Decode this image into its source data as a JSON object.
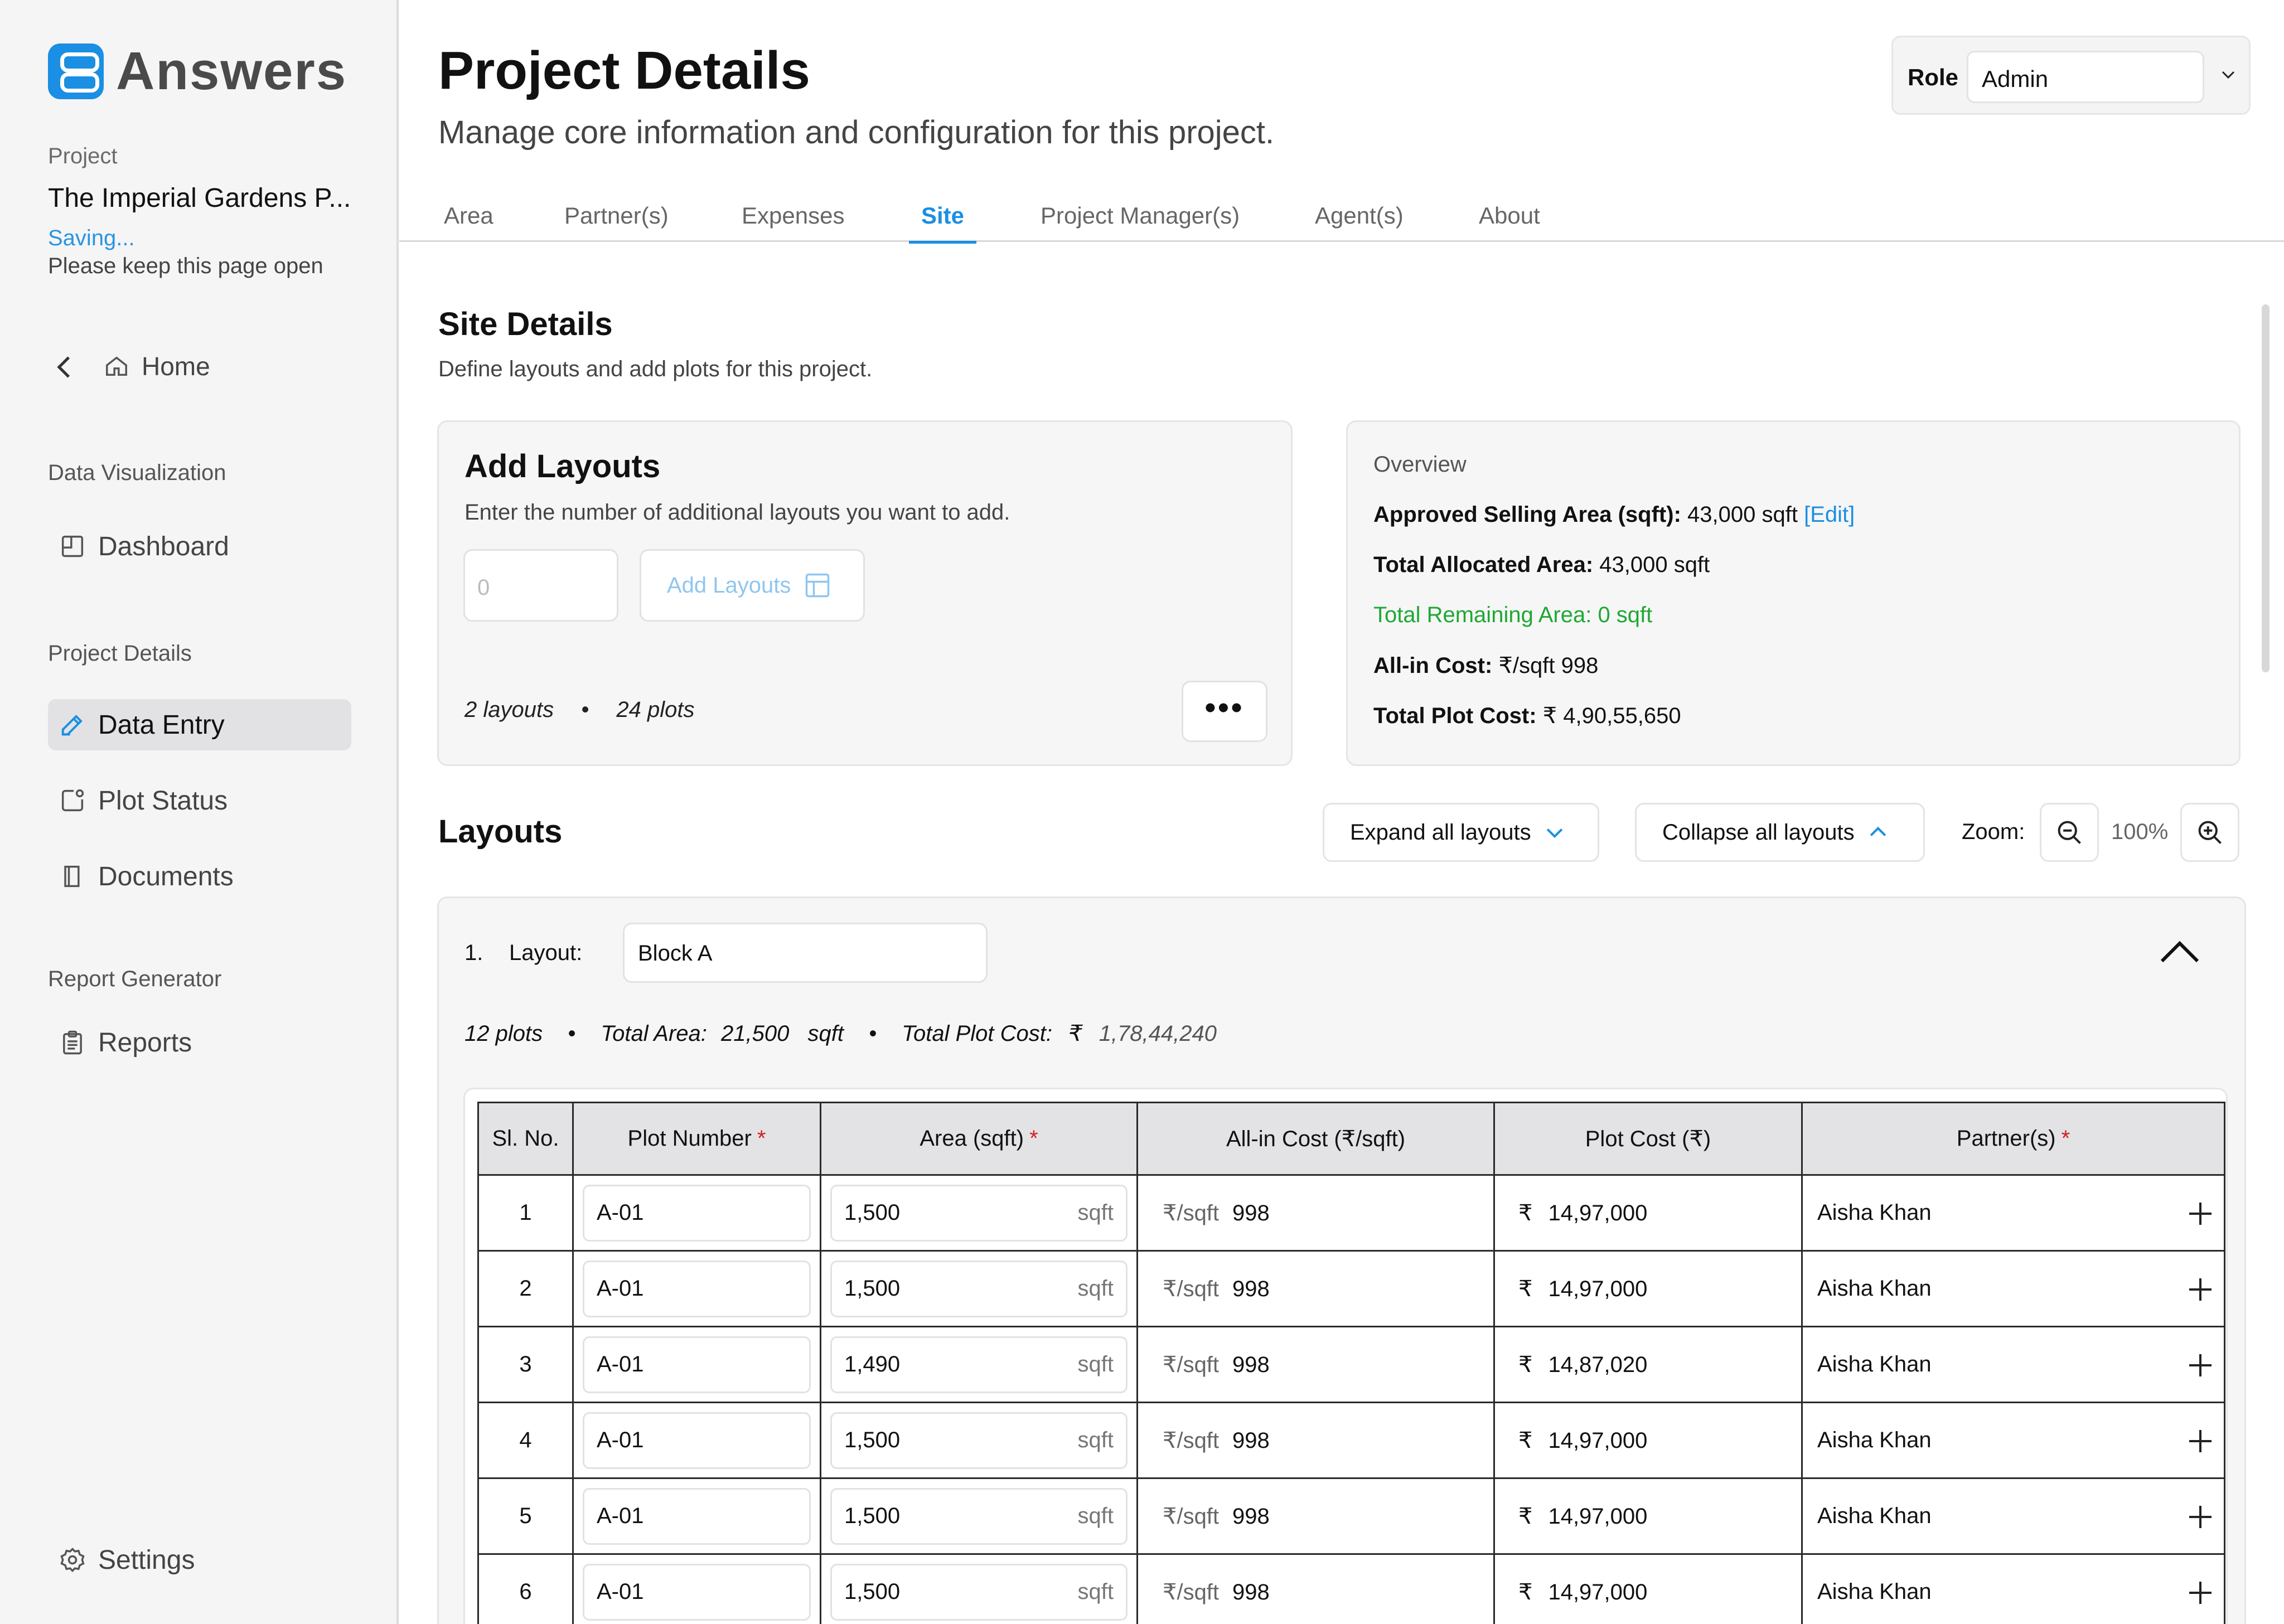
{
  "app": {
    "name": "Answers"
  },
  "sidebar": {
    "project_label": "Project",
    "project_name": "The Imperial Gardens P...",
    "saving": "Saving...",
    "keep_open": "Please keep this page open",
    "home": "Home",
    "sections": [
      {
        "title": "Data Visualization",
        "items": [
          {
            "label": "Dashboard",
            "icon": "dashboard-icon"
          }
        ]
      },
      {
        "title": "Project Details",
        "items": [
          {
            "label": "Data Entry",
            "icon": "edit-icon",
            "active": true
          },
          {
            "label": "Plot Status",
            "icon": "plot-status-icon"
          },
          {
            "label": "Documents",
            "icon": "document-icon"
          }
        ]
      },
      {
        "title": "Report Generator",
        "items": [
          {
            "label": "Reports",
            "icon": "clipboard-icon"
          }
        ]
      }
    ],
    "settings": "Settings"
  },
  "header": {
    "title": "Project Details",
    "subtitle": "Manage core information and configuration for this project.",
    "role_label": "Role",
    "role_value": "Admin"
  },
  "tabs": [
    "Area",
    "Partner(s)",
    "Expenses",
    "Site",
    "Project Manager(s)",
    "Agent(s)",
    "About"
  ],
  "active_tab": "Site",
  "site": {
    "title": "Site Details",
    "subtitle": "Define layouts and add plots for this project."
  },
  "add_layouts": {
    "title": "Add Layouts",
    "subtitle": "Enter the number of additional layouts you want to add.",
    "input_placeholder": "0",
    "button": "Add Layouts",
    "stats_layouts": "2 layouts",
    "stats_sep": "•",
    "stats_plots": "24 plots",
    "more": "•••"
  },
  "overview": {
    "title": "Overview",
    "approved_label": "Approved Selling Area (sqft):",
    "approved_value": "43,000 sqft",
    "edit": "[Edit]",
    "allocated_label": "Total Allocated Area:",
    "allocated_value": "43,000 sqft",
    "remaining": "Total Remaining Area: 0 sqft",
    "allin_label": "All-in Cost:",
    "allin_value": "₹/sqft 998",
    "plotcost_label": "Total Plot Cost:",
    "plotcost_value": "₹ 4,90,55,650"
  },
  "layouts": {
    "title": "Layouts",
    "expand": "Expand all layouts",
    "collapse": "Collapse all layouts",
    "zoom_label": "Zoom:",
    "zoom_value": "100%",
    "items": [
      {
        "num": "1.",
        "label": "Layout:",
        "name": "Block A",
        "plots": "12 plots",
        "sep": "•",
        "area_label": "Total Area:",
        "area_value": "21,500",
        "area_unit": "sqft",
        "cost_label": "Total Plot Cost:",
        "cost_cur": "₹",
        "cost_value": "1,78,44,240"
      }
    ]
  },
  "table": {
    "headers": [
      "Sl. No.",
      "Plot Number",
      "Area (sqft)",
      "All-in Cost (₹/sqft)",
      "Plot Cost (₹)",
      "Partner(s)"
    ],
    "required": "*",
    "unit": "sqft",
    "cost_unit": "₹/sqft",
    "currency": "₹",
    "rows": [
      {
        "sl": "1",
        "plot": "A-01",
        "area": "1,500",
        "allin": "998",
        "cost": "14,97,000",
        "partner": "Aisha Khan"
      },
      {
        "sl": "2",
        "plot": "A-01",
        "area": "1,500",
        "allin": "998",
        "cost": "14,97,000",
        "partner": "Aisha Khan"
      },
      {
        "sl": "3",
        "plot": "A-01",
        "area": "1,490",
        "allin": "998",
        "cost": "14,87,020",
        "partner": "Aisha Khan"
      },
      {
        "sl": "4",
        "plot": "A-01",
        "area": "1,500",
        "allin": "998",
        "cost": "14,97,000",
        "partner": "Aisha Khan"
      },
      {
        "sl": "5",
        "plot": "A-01",
        "area": "1,500",
        "allin": "998",
        "cost": "14,97,000",
        "partner": "Aisha Khan"
      },
      {
        "sl": "6",
        "plot": "A-01",
        "area": "1,500",
        "allin": "998",
        "cost": "14,97,000",
        "partner": "Aisha Khan"
      }
    ]
  },
  "colors": {
    "accent": "#1a8fe3",
    "success": "#1ea832",
    "required": "#d32020"
  }
}
